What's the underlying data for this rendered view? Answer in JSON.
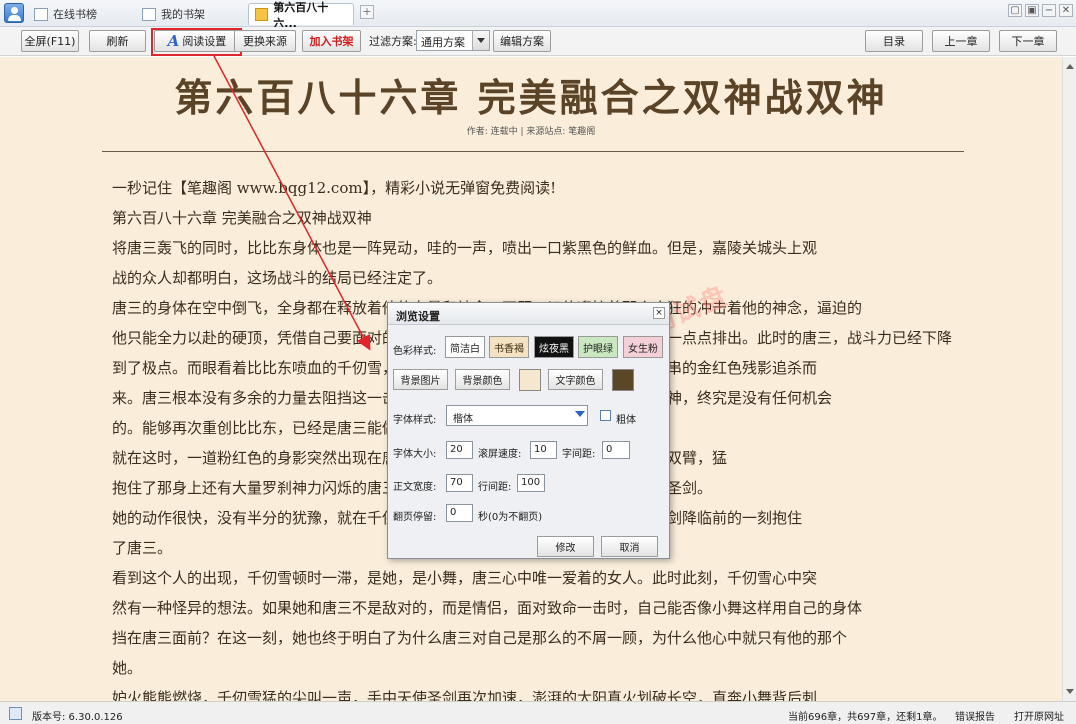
{
  "tabs": [
    {
      "label": "在线书榜",
      "icon": "grid-icon"
    },
    {
      "label": "我的书架",
      "icon": "bookshelf-icon"
    },
    {
      "label": "第六百八十六...",
      "icon": "book-icon",
      "active": true
    }
  ],
  "tab_add": "+",
  "window_buttons": [
    "▢",
    "▣",
    "−",
    "✕"
  ],
  "toolbar": {
    "fullscreen": "全屏(F11)",
    "refresh": "刷新",
    "reading_settings": "阅读设置",
    "change_source": "更换来源",
    "add_to_shelf": "加入书架",
    "filter_label": "过滤方案:",
    "filter_value": "通用方案",
    "edit_scheme": "编辑方案",
    "toc": "目录",
    "prev_chapter": "上一章",
    "next_chapter": "下一章"
  },
  "chapter": {
    "title": "第六百八十六章  完美融合之双神战双神",
    "meta": "作者: 连载中  |  来源站点: 笔趣阁",
    "lines": [
      "一秒记住【笔趣阁 www.bqg12.com】，精彩小说无弹窗免费阅读!",
      "    第六百八十六章  完美融合之双神战双神",
      "    将唐三轰飞的同时，比比东身体也是一阵晃动，哇的一声，喷出一口紫黑色的鲜血。但是，嘉陵关城头上观",
      "战的众人却都明白，这场战斗的结局已经注定了。",
      "    唐三的身体在空中倒飞，全身都在释放着他的力量和神念，不顾一切的迎接着那个疯狂的冲击着他的神念，逼迫的",
      "他只能全力以赴的硬顶，凭借自己要面对的一切去阻挡那宛如地狱般的力量。千仞雪一点点排出。此时的唐三，战斗力已经下降",
      "到了极点。而眼看着比比东喷血的千仞雪，手中天使圣剑高高举起，在空中带起一连串的金红色残影追杀而",
      "来。唐三根本没有多余的力量去阻挡这一击，他甚至已经无法再次凝聚天使神和罗刹神，终究是没有任何机会",
      "的。能够再次重创比比东，已经是唐三能做到的极限了。",
      "    就在这时，一道粉红色的身影突然出现在唐三身前，她没有去阻挡千仞雪，只是张开双臂，猛",
      "抱住了那身上还有大量罗刹神力闪烁的唐三，用自己的后背迎向了那斩落下来的天使圣剑。",
      "    她的动作很快，没有半分的犹豫，就在千仞雪的天使圣剑即将斩落之前，也在天使圣剑降临前的一刻抱住",
      "了唐三。",
      "    看到这个人的出现，千仞雪顿时一滞，是她，是小舞，唐三心中唯一爱着的女人。此时此刻，千仞雪心中突",
      "然有一种怪异的想法。如果她和唐三不是敌对的，而是情侣，面对致命一击时，自己能否像小舞这样用自己的身体",
      "挡在唐三面前？在这一刻，她也终于明白了为什么唐三对自己是那么的不屑一顾，为什么他心中就只有他的那个",
      "她。",
      "    妒火熊熊燃烧，千仞雪猛的尖叫一声，手中天使圣剑再次加速，澎湃的太阳真火划破长空，直奔小舞背后刺"
    ]
  },
  "watermark": "bbs.byhash.com 测试盘",
  "dialog": {
    "title": "浏览设置",
    "close": "×",
    "color_scheme_label": "色彩样式:",
    "schemes": [
      {
        "label": "简洁白",
        "bg": "#ffffff",
        "fg": "#222222"
      },
      {
        "label": "书香褐",
        "bg": "#f4e2c2",
        "fg": "#3a2a10"
      },
      {
        "label": "炫夜黑",
        "bg": "#111111",
        "fg": "#ffffff"
      },
      {
        "label": "护眼绿",
        "bg": "#c9e8c0",
        "fg": "#222222"
      },
      {
        "label": "女生粉",
        "bg": "#f4cfd6",
        "fg": "#222222"
      }
    ],
    "bg_image": "背景图片",
    "bg_color": "背景颜色",
    "bg_color_value": "#f6e7cf",
    "text_color": "文字颜色",
    "text_color_value": "#5b4628",
    "font_style_label": "字体样式:",
    "font_value": "楷体",
    "bold_label": "粗体",
    "font_size_label": "字体大小:",
    "font_size": "20",
    "scroll_speed_label": "滚屏速度:",
    "scroll_speed": "10",
    "char_spacing_label": "字间距:",
    "char_spacing": "0",
    "text_width_label": "正文宽度:",
    "text_width": "70",
    "line_spacing_label": "行间距:",
    "line_spacing": "100",
    "page_pause_label": "翻页停留:",
    "page_pause": "0",
    "page_pause_hint": "秒(0为不翻页)",
    "ok": "修改",
    "cancel": "取消"
  },
  "status": {
    "version": "版本号: 6.30.0.126",
    "position": "当前696章，共697章，还剩1章。",
    "report": "错误报告",
    "open_url": "打开原网址"
  },
  "colors": {
    "reader_bg": "#faeedb",
    "annotation_red": "#e0262b"
  }
}
